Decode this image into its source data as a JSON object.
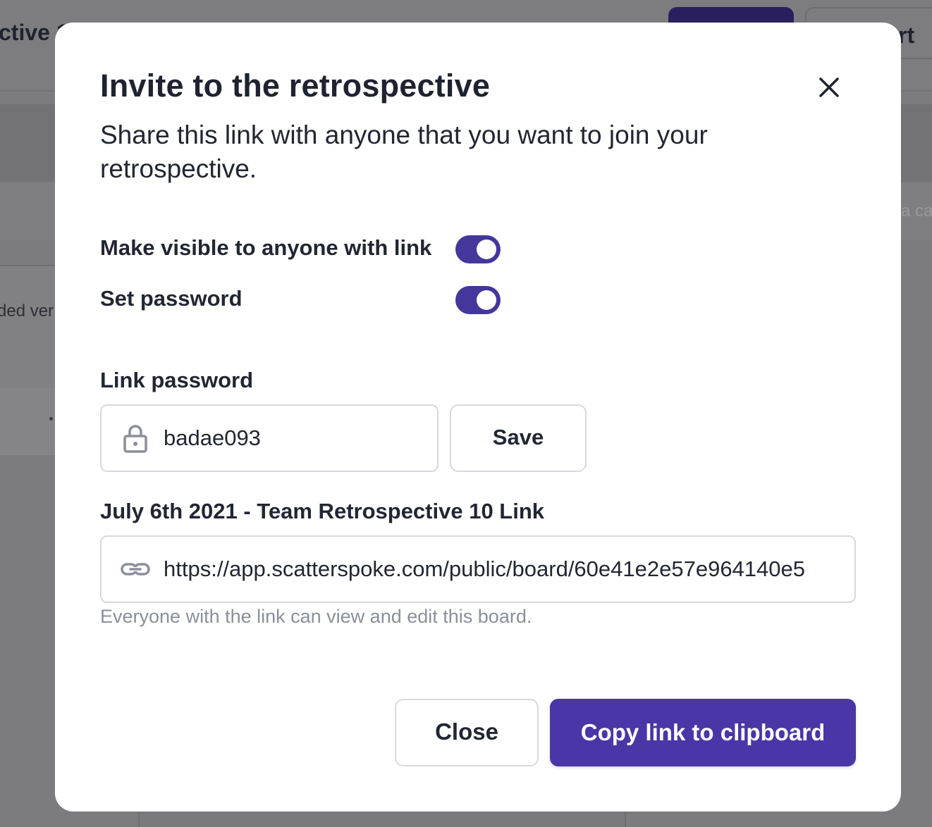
{
  "background": {
    "page_title_fragment": "ctive 1",
    "export_button_fragment": "rt",
    "search_placeholder_fragment": "a ca",
    "panel_text_fragment": "ded ver"
  },
  "modal": {
    "title": "Invite to the retrospective",
    "description": "Share this link with anyone that you want to join your retrospective.",
    "toggles": [
      {
        "label": "Make visible to anyone with link",
        "on": true
      },
      {
        "label": "Set password",
        "on": true
      }
    ],
    "password": {
      "label": "Link password",
      "value": "badae093",
      "icon": "lock-icon",
      "save_label": "Save"
    },
    "link": {
      "label": "July 6th 2021 - Team Retrospective 10 Link",
      "url": "https://app.scatterspoke.com/public/board/60e41e2e57e964140e5",
      "icon": "link-icon",
      "hint": "Everyone with the link can view and edit this board."
    },
    "buttons": {
      "close_label": "Close",
      "copy_label": "Copy link to clipboard"
    }
  },
  "colors": {
    "accent": "#4a36a6",
    "toggle_on": "#43379b",
    "overlay": "#7c7c7e",
    "hint_text": "#8a8f9a"
  }
}
